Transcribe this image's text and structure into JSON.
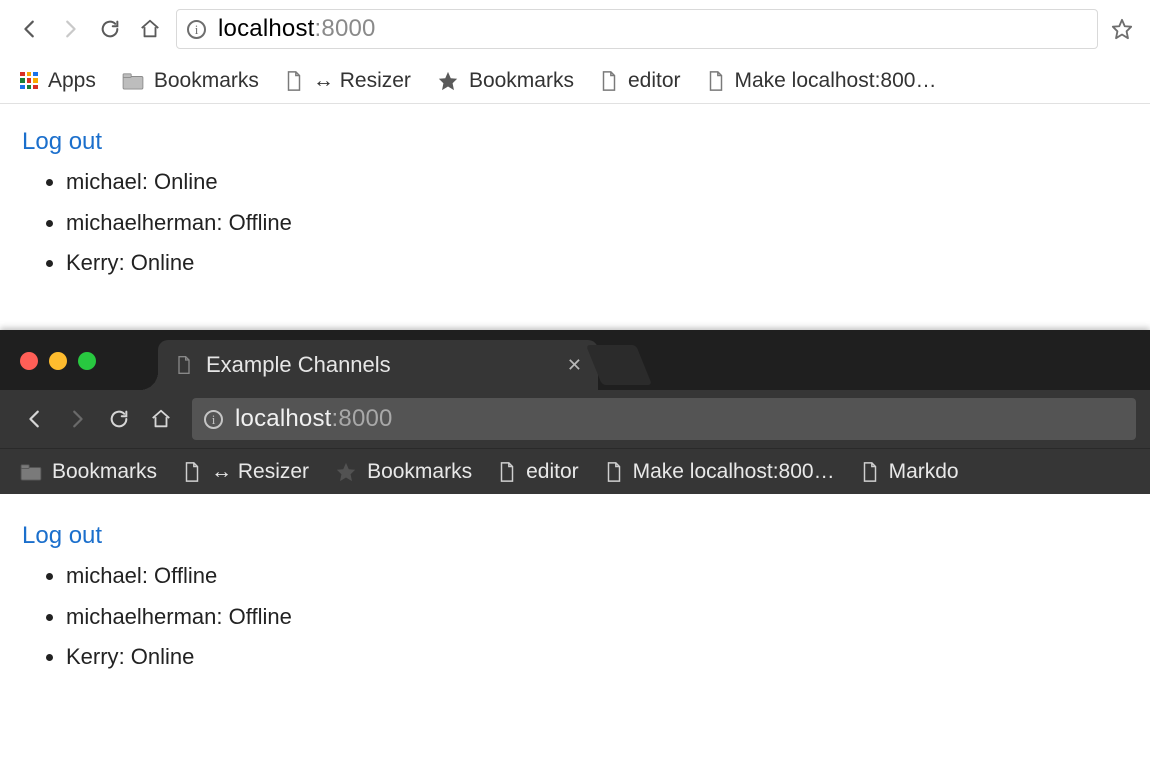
{
  "top": {
    "url_host": "localhost",
    "url_path": ":8000",
    "bookmarks": {
      "apps": "Apps",
      "folder": "Bookmarks",
      "resizer": "↔ Resizer",
      "star_folder": "Bookmarks",
      "editor": "editor",
      "make": "Make localhost:800…"
    },
    "page": {
      "logout": "Log out",
      "users": [
        {
          "name": "michael",
          "status": "Online"
        },
        {
          "name": "michaelherman",
          "status": "Offline"
        },
        {
          "name": "Kerry",
          "status": "Online"
        }
      ]
    }
  },
  "bottom": {
    "tab_title": "Example Channels",
    "url_host": "localhost",
    "url_path": ":8000",
    "bookmarks": {
      "folder": "Bookmarks",
      "resizer": "↔ Resizer",
      "star_folder": "Bookmarks",
      "editor": "editor",
      "make": "Make localhost:800…",
      "markdown": "Markdo"
    },
    "page": {
      "logout": "Log out",
      "users": [
        {
          "name": "michael",
          "status": "Offline"
        },
        {
          "name": "michaelherman",
          "status": "Offline"
        },
        {
          "name": "Kerry",
          "status": "Online"
        }
      ]
    }
  }
}
